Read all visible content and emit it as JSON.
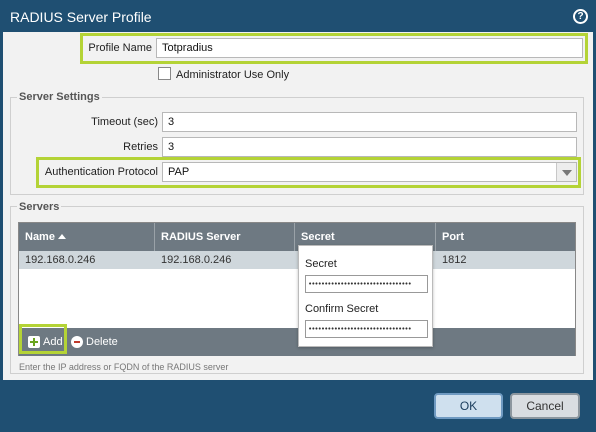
{
  "window": {
    "title": "RADIUS Server Profile",
    "help_icon": "?"
  },
  "profile": {
    "name_label": "Profile Name",
    "name_value": "Totpradius",
    "admin_only_label": "Administrator Use Only"
  },
  "server_settings": {
    "legend": "Server Settings",
    "timeout_label": "Timeout (sec)",
    "timeout_value": "3",
    "retries_label": "Retries",
    "retries_value": "3",
    "auth_label": "Authentication Protocol",
    "auth_value": "PAP"
  },
  "servers": {
    "legend": "Servers",
    "columns": [
      "Name",
      "RADIUS Server",
      "Secret",
      "Port"
    ],
    "rows": [
      {
        "name": "192.168.0.246",
        "radius_server": "192.168.0.246",
        "port": "1812"
      }
    ],
    "add_label": "Add",
    "delete_label": "Delete",
    "hint": "Enter the IP address or FQDN of the RADIUS server"
  },
  "secret_popover": {
    "secret_label": "Secret",
    "secret_mask": "••••••••••••••••••••••••••••••••",
    "confirm_label": "Confirm Secret",
    "confirm_mask": "••••••••••••••••••••••••••••••••"
  },
  "buttons": {
    "ok": "OK",
    "cancel": "Cancel"
  },
  "colors": {
    "highlight": "#b4d336",
    "title_bar": "#1f4f72"
  }
}
